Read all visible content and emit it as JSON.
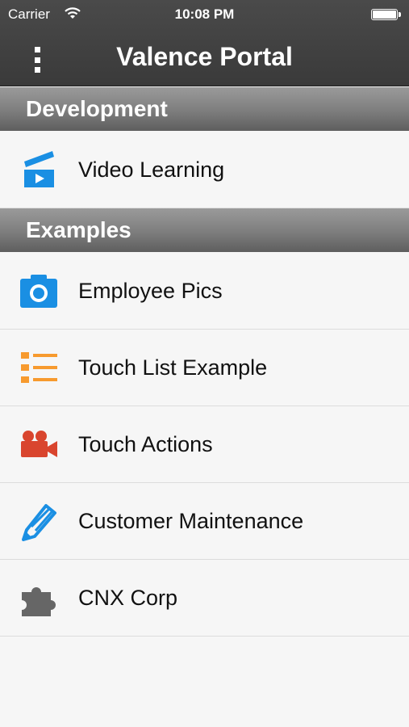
{
  "status_bar": {
    "carrier": "Carrier",
    "time": "10:08 PM"
  },
  "nav": {
    "title": "Valence Portal",
    "menu_icon": "vertical-dots-menu-icon"
  },
  "sections": [
    {
      "title": "Development",
      "items": [
        {
          "label": "Video Learning",
          "icon": "clapperboard-icon",
          "color": "#1a8fe3"
        }
      ]
    },
    {
      "title": "Examples",
      "items": [
        {
          "label": "Employee Pics",
          "icon": "camera-icon",
          "color": "#1a8fe3"
        },
        {
          "label": "Touch List Example",
          "icon": "list-icon",
          "color": "#f79a2e"
        },
        {
          "label": "Touch Actions",
          "icon": "video-camera-icon",
          "color": "#d9452e"
        },
        {
          "label": "Customer Maintenance",
          "icon": "pencil-icon",
          "color": "#1a8fe3"
        },
        {
          "label": "CNX Corp",
          "icon": "puzzle-icon",
          "color": "#666666"
        }
      ]
    }
  ],
  "colors": {
    "header_bg": "#3d3d3d",
    "section_bg": "#7d7d7d",
    "list_bg": "#f6f6f6"
  }
}
